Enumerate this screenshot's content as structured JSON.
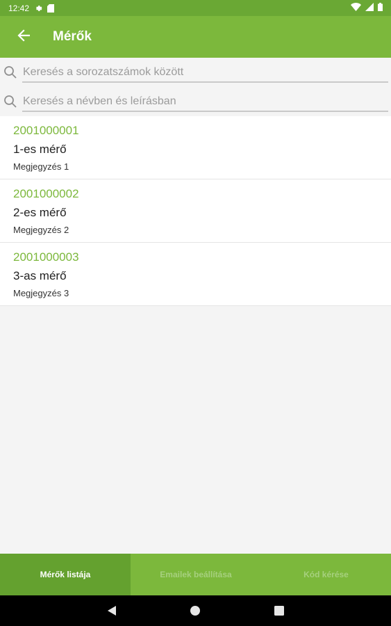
{
  "status_bar": {
    "time": "12:42",
    "icons": [
      "settings-icon",
      "sd-card-icon",
      "wifi-icon",
      "signal-icon",
      "battery-icon"
    ]
  },
  "app_bar": {
    "title": "Mérők",
    "back_icon": "arrow-back-icon",
    "color": "#7cb83c"
  },
  "search": {
    "serial_placeholder": "Keresés a sorozatszámok között",
    "serial_value": "",
    "name_placeholder": "Keresés a névben és leírásban",
    "name_value": "",
    "icon": "search-icon"
  },
  "meters": [
    {
      "serial": "2001000001",
      "name": "1-es mérő",
      "note": "Megjegyzés 1"
    },
    {
      "serial": "2001000002",
      "name": "2-es mérő",
      "note": "Megjegyzés 2"
    },
    {
      "serial": "2001000003",
      "name": "3-as mérő",
      "note": "Megjegyzés 3"
    }
  ],
  "bottom_tabs": {
    "items": [
      {
        "label": "Mérők listája",
        "active": true
      },
      {
        "label": "Emailek beállítása",
        "active": false
      },
      {
        "label": "Kód kérése",
        "active": false
      }
    ]
  },
  "nav_bar": {
    "icons": [
      "back-triangle-icon",
      "home-circle-icon",
      "recents-square-icon"
    ]
  },
  "colors": {
    "accent": "#7cb83c",
    "accent_dark": "#64a12f",
    "status_bar": "#6aa834",
    "inactive_tab_text": "#a6d07e"
  }
}
